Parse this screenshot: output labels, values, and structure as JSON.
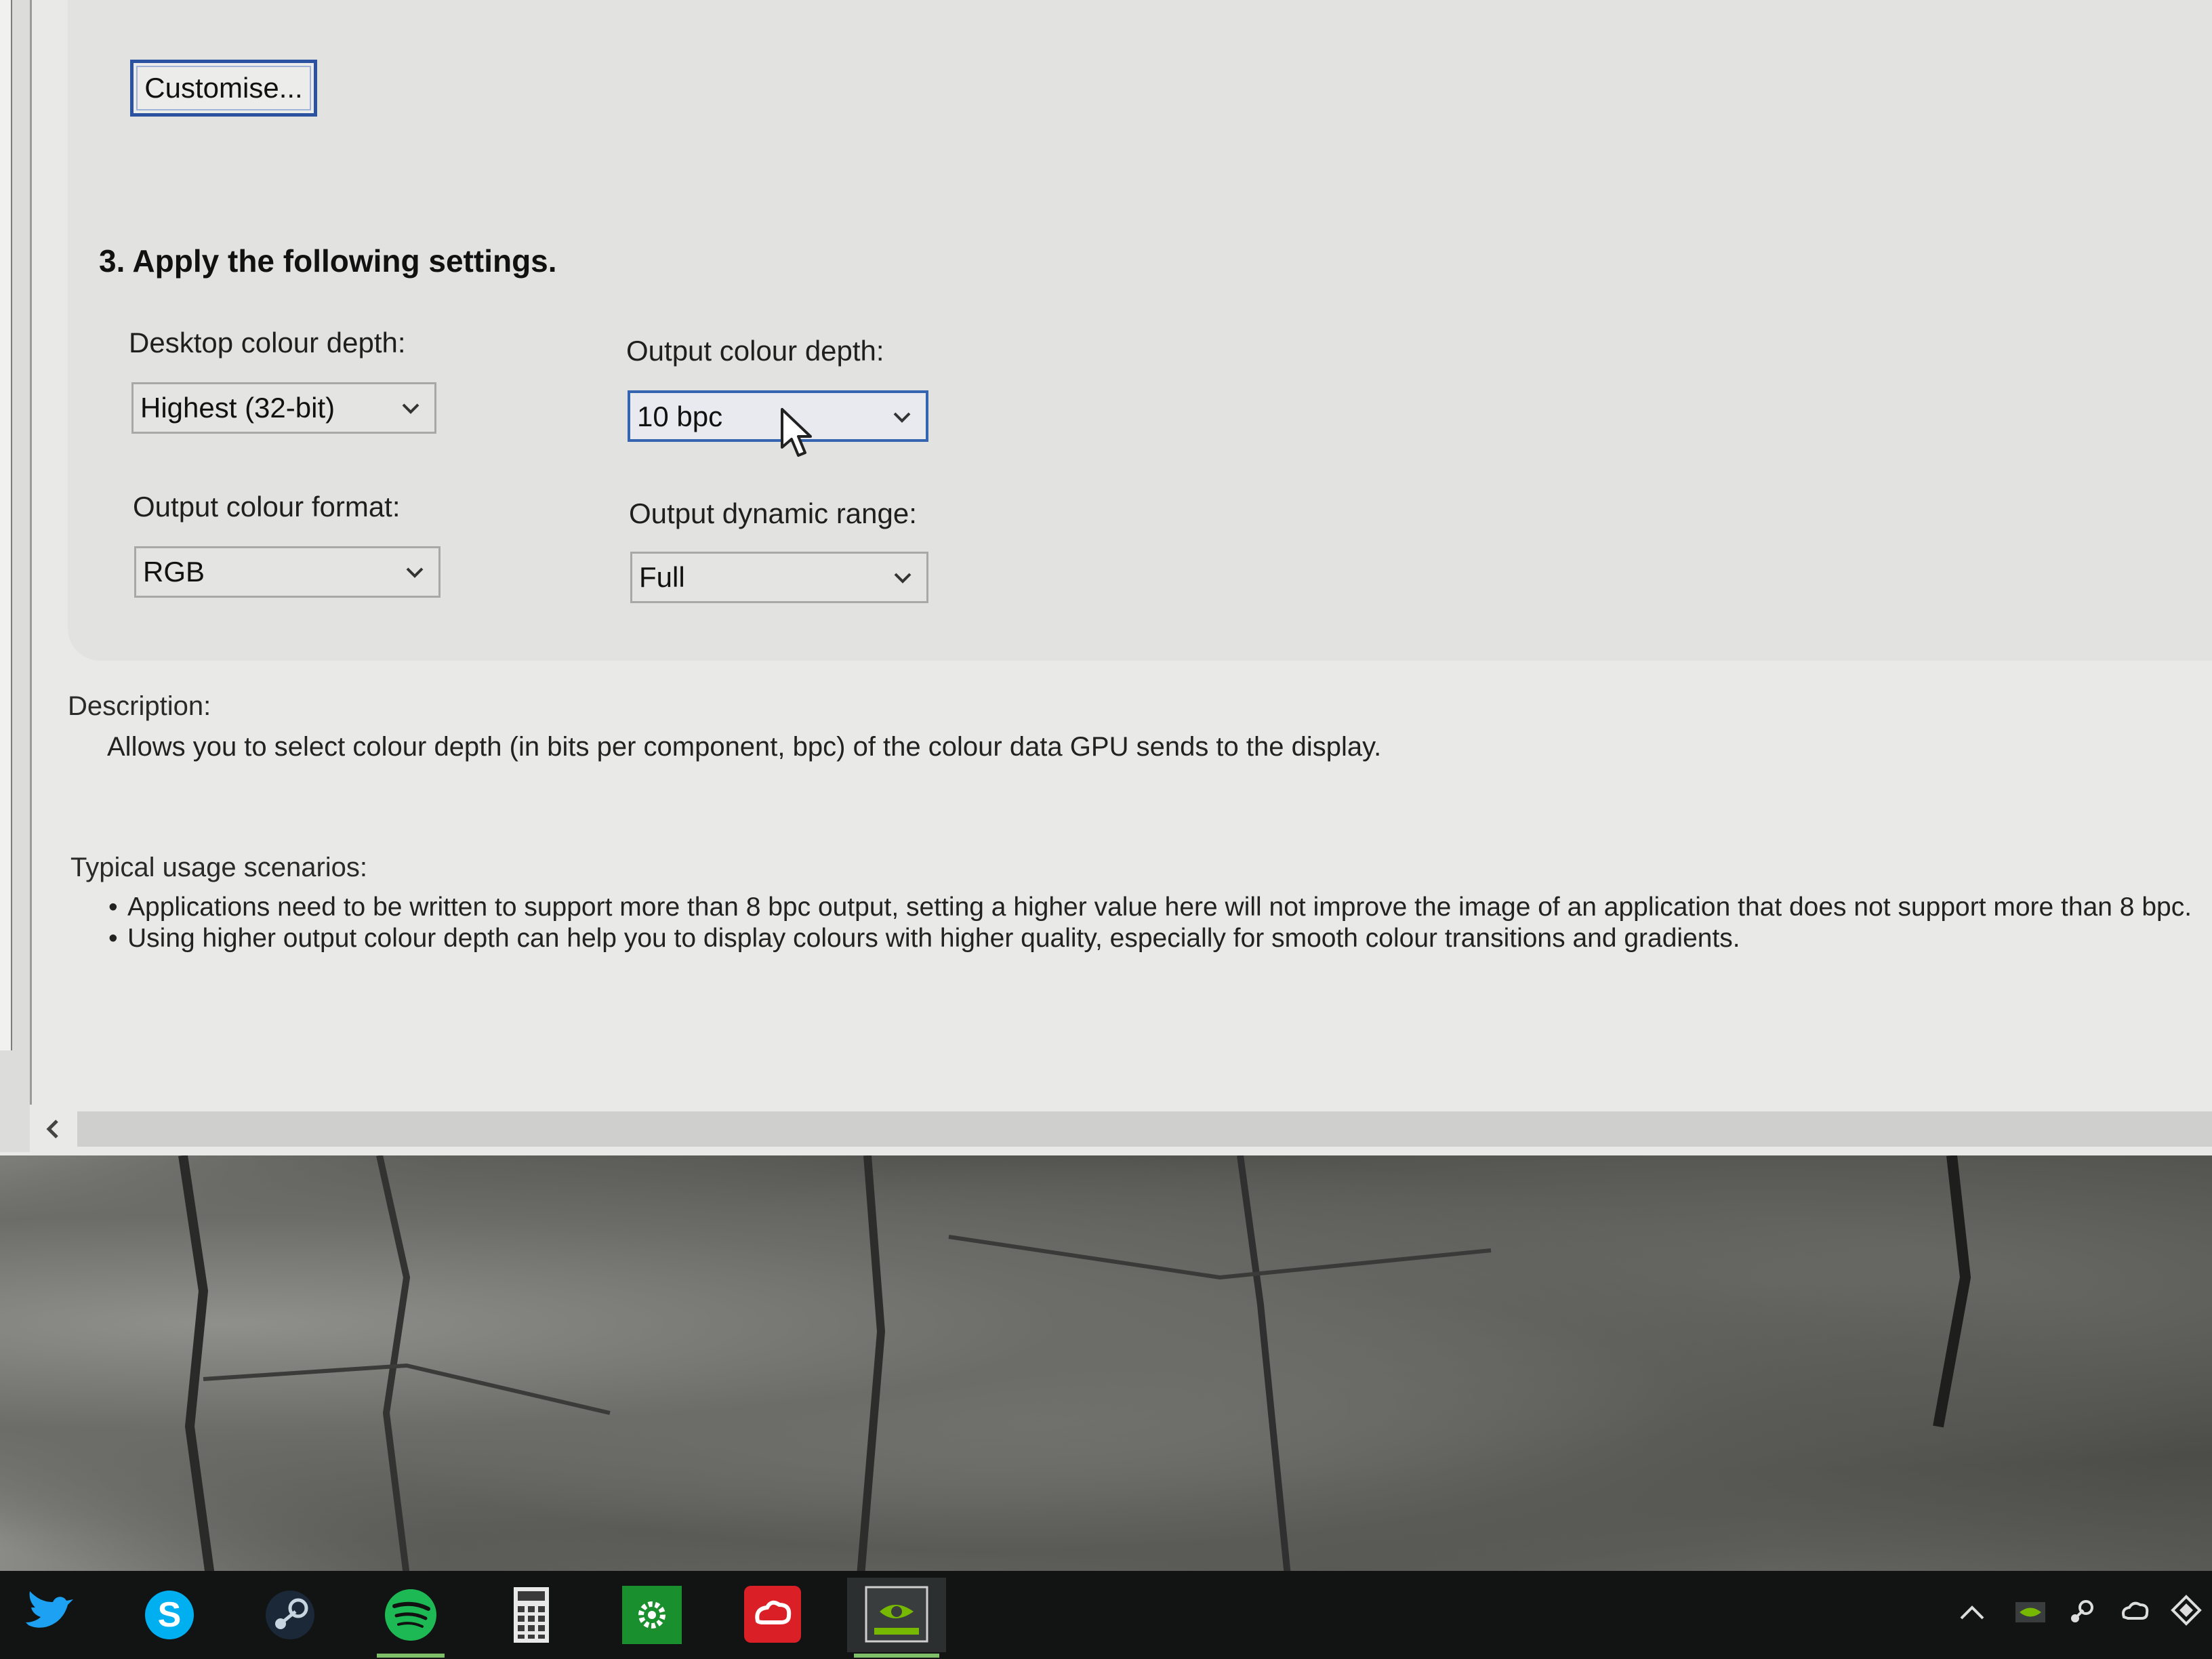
{
  "window": {
    "customise_button": "Customise...",
    "section_heading": "3. Apply the following settings.",
    "desktop_colour_depth": {
      "label": "Desktop colour depth:",
      "value": "Highest (32-bit)"
    },
    "output_colour_depth": {
      "label": "Output colour depth:",
      "value": "10 bpc"
    },
    "output_colour_format": {
      "label": "Output colour format:",
      "value": "RGB"
    },
    "output_dynamic_range": {
      "label": "Output dynamic range:",
      "value": "Full"
    },
    "description": {
      "label": "Description:",
      "text": "Allows you to select colour depth (in bits per component, bpc) of the colour data GPU sends to the display."
    },
    "typical_usage": {
      "label": "Typical usage scenarios:",
      "items": [
        "Applications need to be written to support more than 8 bpc output, setting a higher value here will not improve the image of an application that does not support more than 8 bpc.",
        "Using higher output colour depth can help you to display colours with higher quality, especially for smooth colour transitions and gradients."
      ]
    },
    "scrollbar_left_glyph": "<"
  },
  "taskbar": {
    "apps": [
      {
        "icon": "twitter-icon"
      },
      {
        "icon": "skype-icon"
      },
      {
        "icon": "steam-icon"
      },
      {
        "icon": "spotify-icon"
      },
      {
        "icon": "calculator-icon"
      },
      {
        "icon": "settings-gear-icon"
      },
      {
        "icon": "creative-cloud-icon"
      },
      {
        "icon": "nvidia-control-panel-icon"
      }
    ],
    "tray": [
      {
        "icon": "chevron-up-icon"
      },
      {
        "icon": "nvidia-tray-icon"
      },
      {
        "icon": "steam-tray-icon"
      },
      {
        "icon": "creative-cloud-tray-icon"
      },
      {
        "icon": "dropbox-tray-icon"
      }
    ]
  },
  "colors": {
    "accent_blue": "#2a52a0",
    "spotify_green": "#1db954",
    "nvidia_green": "#76b900",
    "twitter_blue": "#1da1f2",
    "skype_blue": "#00aff0",
    "adobe_red": "#da1f26"
  }
}
